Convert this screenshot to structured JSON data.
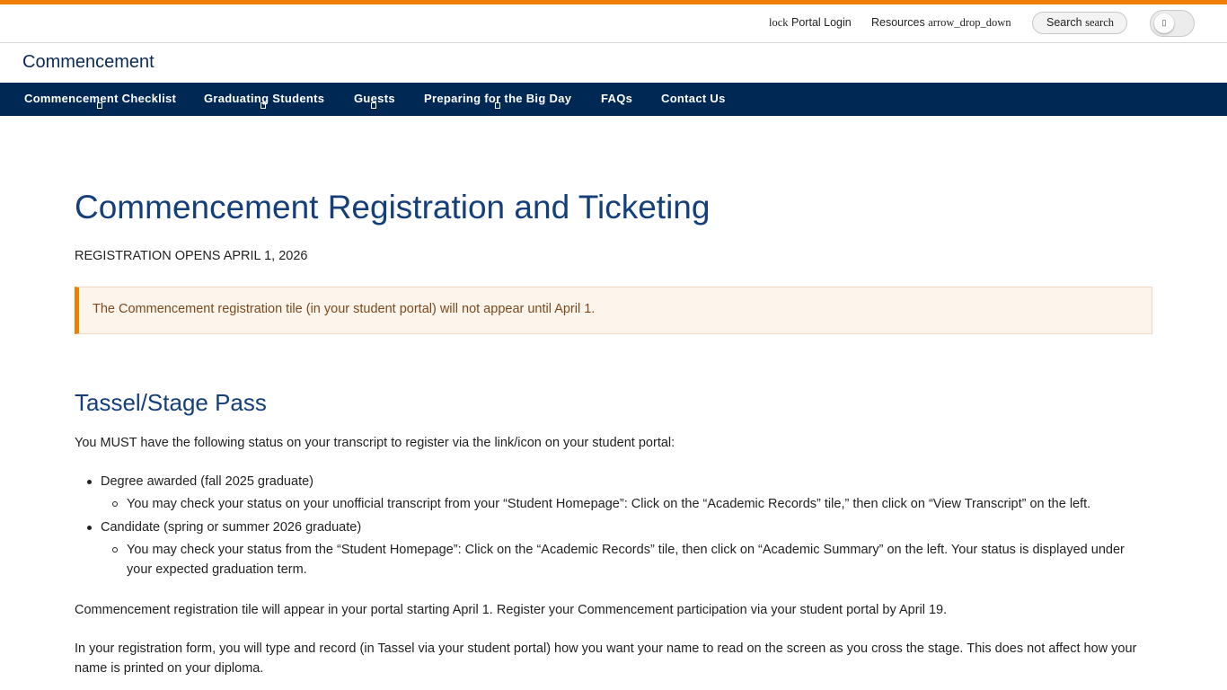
{
  "utility": {
    "portal_login_icon": "lock",
    "portal_login_label": "Portal Login",
    "resources_label": "Resources",
    "resources_icon": "arrow_drop_down",
    "search_label": "Search",
    "search_icon": "search",
    "toggle_glyph": "▯"
  },
  "site": {
    "title": "Commencement"
  },
  "nav": {
    "items": [
      {
        "label": "Commencement Checklist"
      },
      {
        "label": "Graduating Students"
      },
      {
        "label": "Guests"
      },
      {
        "label": "Preparing for the Big Day"
      },
      {
        "label": "FAQs"
      },
      {
        "label": "Contact Us"
      }
    ]
  },
  "main": {
    "title": "Commencement Registration and Ticketing",
    "registration_opens": "REGISTRATION OPENS APRIL 1, 2026",
    "alert": "The Commencement registration tile (in your student portal) will not appear until April 1.",
    "section_heading": "Tassel/Stage Pass",
    "intro": "You MUST have the following status on your transcript to register via the link/icon on your student portal:",
    "status_list": [
      {
        "label": "Degree awarded (fall 2025 graduate)",
        "sub": "You may check your status on your unofficial transcript from your “Student Homepage”: Click on the “Academic Records” tile,” then click on “View Transcript” on the left."
      },
      {
        "label": "Candidate (spring or summer 2026 graduate)",
        "sub": "You may check your status from the “Student Homepage”: Click on the “Academic Records” tile, then click on “Academic Summary” on the left. Your status is displayed under your expected graduation term."
      }
    ],
    "para_tile": "Commencement registration tile will appear in your portal starting April 1. Register your Commencement participation via your student portal by April 19.",
    "para_name": "In your registration form, you will type and record (in Tassel via your student portal) how you want your name to read on the screen as you cross the stage. This does not affect how your name is printed on your diploma."
  },
  "colors": {
    "accent_orange": "#f07d00",
    "nav_navy": "#002855",
    "heading_blue": "#143f7a",
    "alert_bg": "#fdf4ec"
  }
}
